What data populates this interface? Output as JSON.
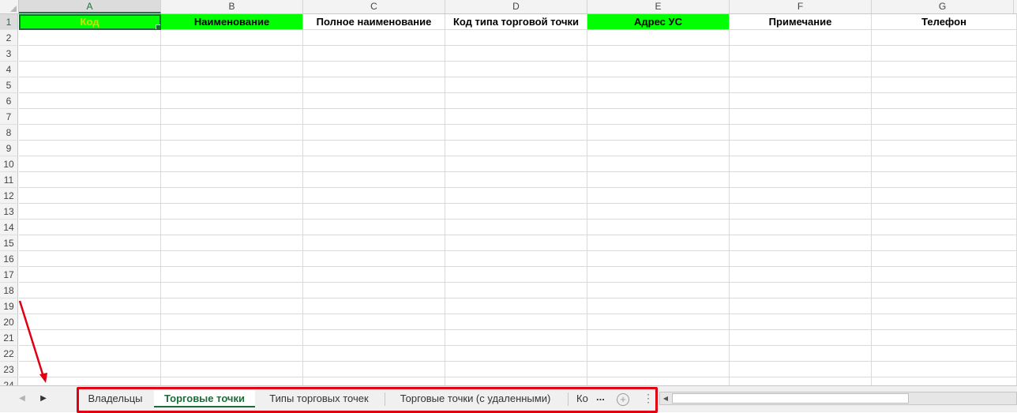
{
  "columns": [
    {
      "letter": "A",
      "header": "Код"
    },
    {
      "letter": "B",
      "header": "Наименование"
    },
    {
      "letter": "C",
      "header": "Полное наименование"
    },
    {
      "letter": "D",
      "header": "Код типа торговой точки"
    },
    {
      "letter": "E",
      "header": "Адрес УС"
    },
    {
      "letter": "F",
      "header": "Примечание"
    },
    {
      "letter": "G",
      "header": "Телефон"
    }
  ],
  "rows": [
    "1",
    "2",
    "3",
    "4",
    "5",
    "6",
    "7",
    "8",
    "9",
    "10",
    "11",
    "12",
    "13",
    "14",
    "15",
    "16",
    "17",
    "18",
    "19",
    "20",
    "21",
    "22",
    "23",
    "24"
  ],
  "colors": {
    "header_green": "#00ff00",
    "selected_header_text": "#e8d400",
    "excel_green": "#1e6b3a",
    "annotation_red": "#e00012"
  },
  "sheet_tabs": [
    {
      "label": "Владельцы",
      "active": false
    },
    {
      "label": "Торговые точки",
      "active": true
    },
    {
      "label": "Типы торговых точек",
      "active": false
    },
    {
      "label": "Торговые точки (с удаленными)",
      "active": false
    },
    {
      "label": "Ко",
      "active": false
    }
  ],
  "sheetbar": {
    "ellipsis": "...",
    "add_icon": "plus-circle-icon",
    "menu_icon": "vertical-dots-icon",
    "nav_left_icon": "triangle-left-icon",
    "nav_right_icon": "triangle-right-icon"
  }
}
